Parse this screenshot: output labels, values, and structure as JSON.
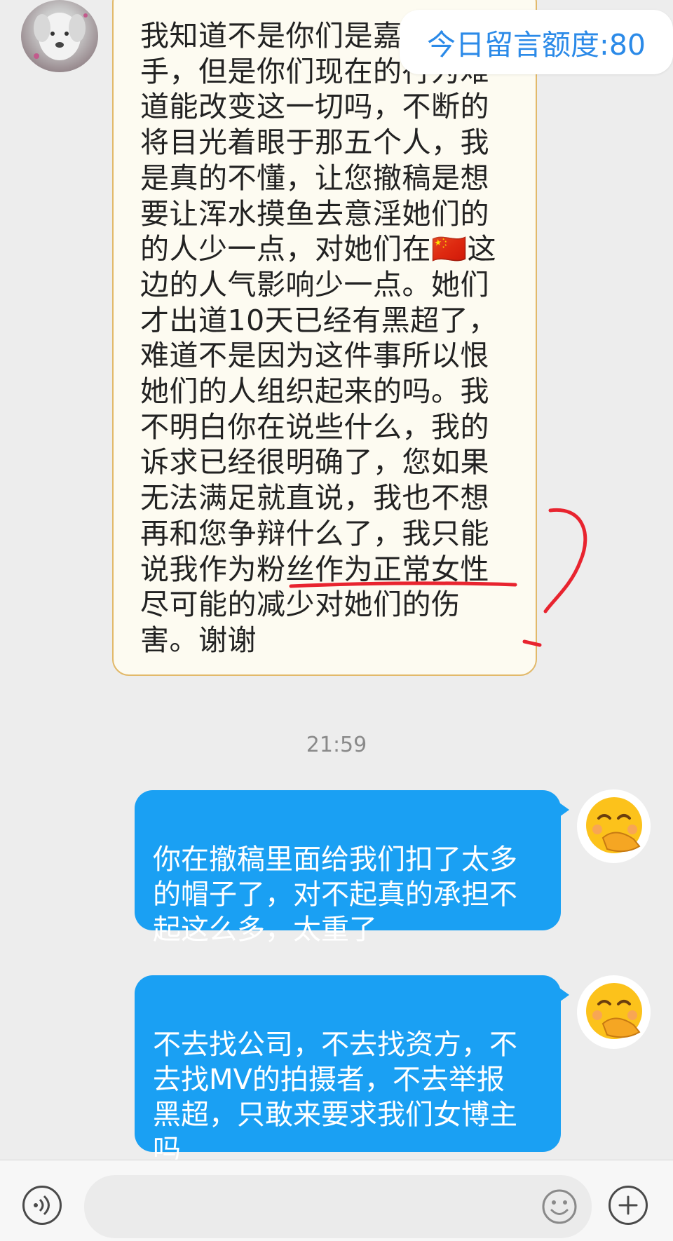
{
  "quota_label": "今日留言额度:80",
  "incoming_message": "我知道不是你们是嘉手，但是你们现在的行为难道能改变这一切吗，不断的将目光着眼于那五个人，我是真的不懂，让您撤稿是想要让浑水摸鱼去意淫她们的的人少一点，对她们在🇨🇳这边的人气影响少一点。她们才出道10天已经有黑超了，难道不是因为这件事所以恨她们的人组织起来的吗。我不明白你在说些什么，我的诉求已经很明确了，您如果无法满足就直说，我也不想再和您争辩什么了，我只能说我作为粉丝作为正常女性尽可能的减少对她们的伤害。谢谢",
  "incoming_lines": "我知道不是你们是嘉\n手，但是你们现在的行为难\n道能改变这一切吗，不断的\n将目光着眼于那五个人，我\n是真的不懂，让您撤稿是想\n要让浑水摸鱼去意淫她们的\n的人少一点，对她们在🇨🇳这\n边的人气影响少一点。她们\n才出道10天已经有黑超了，\n难道不是因为这件事所以恨\n她们的人组织起来的吗。我\n不明白你在说些什么，我的\n诉求已经很明确了，您如果\n无法满足就直说，我也不想\n再和您争辩什么了，我只能\n说我作为粉丝作为正常女性\n尽可能的减少对她们的伤\n害。谢谢",
  "timestamp": "21:59",
  "outgoing_messages": [
    "你在撤稿里面给我们扣了太多\n的帽子了，对不起真的承担不\n起这么多，太重了",
    "不去找公司，不去找资方，不\n去找MV的拍摄者，不去举报\n黑超，只敢来要求我们女博主\n吗"
  ],
  "icons": {
    "voice": "voice-icon",
    "emoji": "emoji-icon",
    "plus": "plus-icon",
    "sender_avatar": "puppy-avatar",
    "self_avatar": "face-with-hand-over-mouth-emoji"
  },
  "colors": {
    "outgoing_bubble": "#1aa0f3",
    "incoming_bubble": "#fdfbf1",
    "quota_text": "#2b8ae8",
    "annotation_red": "#e8242f"
  }
}
